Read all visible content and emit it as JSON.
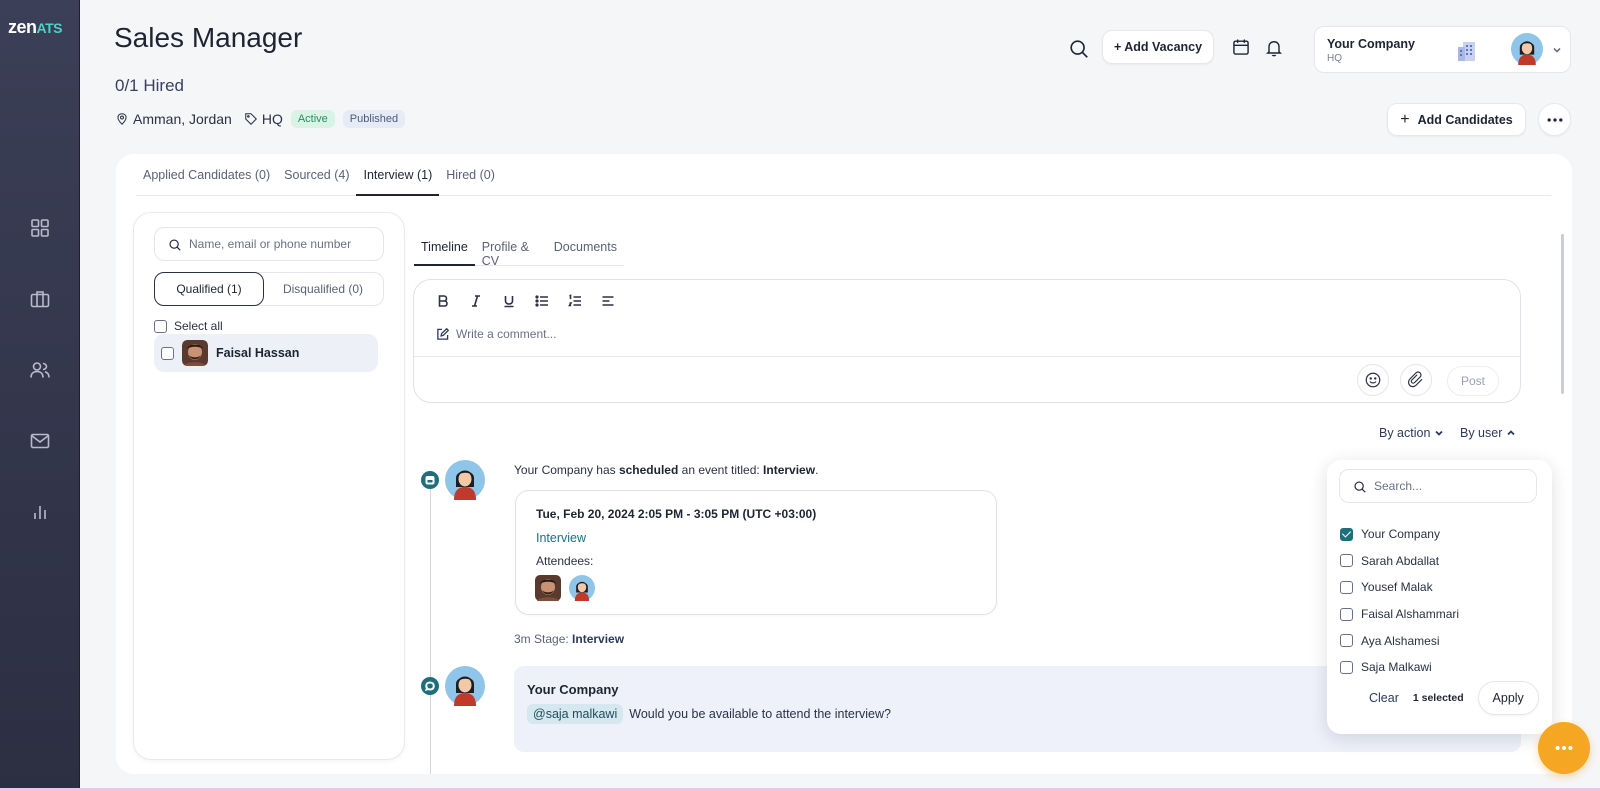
{
  "app": {
    "logo_main": "zen",
    "logo_accent": "ATS"
  },
  "sidebar": {
    "items": [
      {
        "icon": "dashboard-grid-icon"
      },
      {
        "icon": "briefcase-icon"
      },
      {
        "icon": "users-icon"
      },
      {
        "icon": "mail-icon"
      },
      {
        "icon": "bar-chart-icon"
      }
    ]
  },
  "header": {
    "title": "Sales Manager",
    "hired": "0/1 Hired",
    "location": "Amman, Jordan",
    "tag": "HQ",
    "status_badge": "Active",
    "publish_badge": "Published",
    "add_vacancy": "+ Add Vacancy",
    "company_name": "Your Company",
    "company_sub": "HQ",
    "add_candidates": "Add Candidates"
  },
  "tabs": [
    "Applied Candidates (0)",
    "Sourced (4)",
    "Interview (1)",
    "Hired (0)"
  ],
  "left_panel": {
    "search_placeholder": "Name, email or phone number",
    "qualified": "Qualified (1)",
    "disqualified": "Disqualified (0)",
    "select_all": "Select all",
    "candidate_name": "Faisal Hassan"
  },
  "sub_tabs": [
    "Timeline",
    "Profile & CV",
    "Documents"
  ],
  "editor": {
    "placeholder": "Write a comment...",
    "post": "Post"
  },
  "filters": {
    "by_action": "By action",
    "by_user": "By user"
  },
  "timeline": {
    "event_actor": "Your Company",
    "event_mid": " has ",
    "event_verb": "scheduled",
    "event_mid2": " an event titled: ",
    "event_title": "Interview",
    "event_end": ".",
    "event_date": "Tue, Feb 20, 2024 2:05 PM - 3:05 PM (UTC +03:00)",
    "event_type": "Interview",
    "attendees_label": "Attendees:",
    "stage_prefix": "3m Stage: ",
    "stage_value": "Interview",
    "comment_author": "Your Company",
    "comment_mention": "@saja malkawi",
    "comment_text": "Would you be available to attend the interview?"
  },
  "user_filter": {
    "search_placeholder": "Search...",
    "users": [
      {
        "name": "Your Company",
        "checked": true
      },
      {
        "name": "Sarah Abdallat",
        "checked": false
      },
      {
        "name": "Yousef Malak",
        "checked": false
      },
      {
        "name": "Faisal Alshammari",
        "checked": false
      },
      {
        "name": "Aya Alshamesi",
        "checked": false
      },
      {
        "name": "Saja Malkawi",
        "checked": false
      }
    ],
    "clear": "Clear",
    "selected_count": "1 selected",
    "apply": "Apply"
  },
  "colors": {
    "accent": "#1f6f7b",
    "sidebar": "#3b3f57",
    "fab": "#f5a623"
  }
}
